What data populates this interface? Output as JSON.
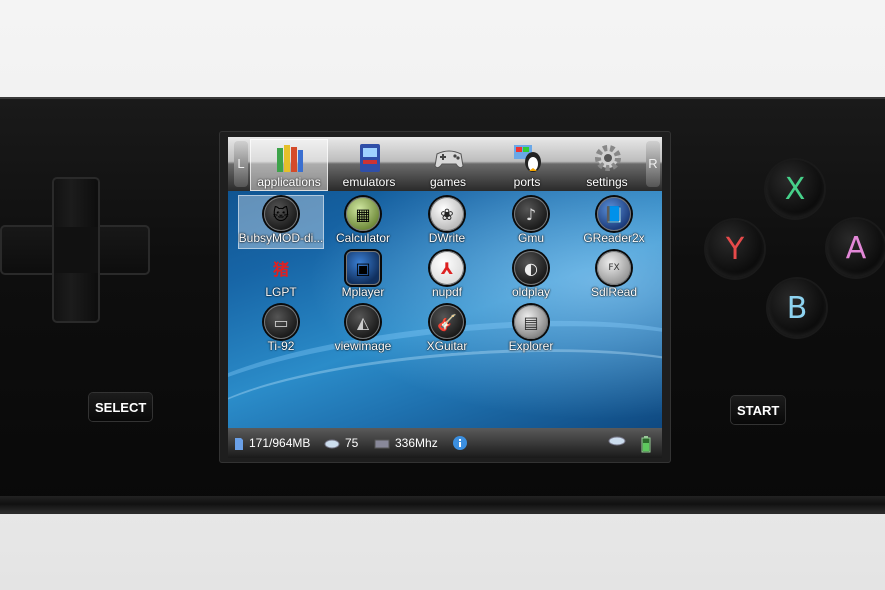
{
  "device": {
    "buttons": {
      "x": "X",
      "y": "Y",
      "a": "A",
      "b": "B",
      "select": "SELECT",
      "start": "START"
    },
    "button_colors": {
      "x": "#46d18a",
      "y": "#e64a4a",
      "a": "#e388d8",
      "b": "#8ed3f0"
    }
  },
  "launcher": {
    "shoulders": {
      "left": "L",
      "right": "R"
    },
    "tabs": [
      {
        "label": "applications",
        "icon": "books-icon",
        "selected": true
      },
      {
        "label": "emulators",
        "icon": "arcade-cabinet-icon"
      },
      {
        "label": "games",
        "icon": "gamepad-icon"
      },
      {
        "label": "ports",
        "icon": "penguin-icon"
      },
      {
        "label": "settings",
        "icon": "gear-icon"
      }
    ],
    "apps": [
      {
        "label": "BubsyMOD-di...",
        "icon": "game-icon",
        "selected": true
      },
      {
        "label": "Calculator",
        "icon": "calculator-icon"
      },
      {
        "label": "DWrite",
        "icon": "paw-icon"
      },
      {
        "label": "Gmu",
        "icon": "music-note-icon"
      },
      {
        "label": "GReader2x",
        "icon": "book-icon"
      },
      {
        "label": "LGPT",
        "icon": "kanji-icon"
      },
      {
        "label": "Mplayer",
        "icon": "video-icon"
      },
      {
        "label": "nupdf",
        "icon": "pdf-icon"
      },
      {
        "label": "oldplay",
        "icon": "disc-icon"
      },
      {
        "label": "SdlRead",
        "icon": "reader-icon"
      },
      {
        "label": "Ti-92",
        "icon": "calculator-device-icon"
      },
      {
        "label": "viewimage",
        "icon": "image-icon"
      },
      {
        "label": "XGuitar",
        "icon": "guitar-icon"
      },
      {
        "label": "Explorer",
        "icon": "folder-icon"
      }
    ],
    "status": {
      "storage": "171/964MB",
      "brightness": "75",
      "cpu": "336Mhz"
    }
  }
}
